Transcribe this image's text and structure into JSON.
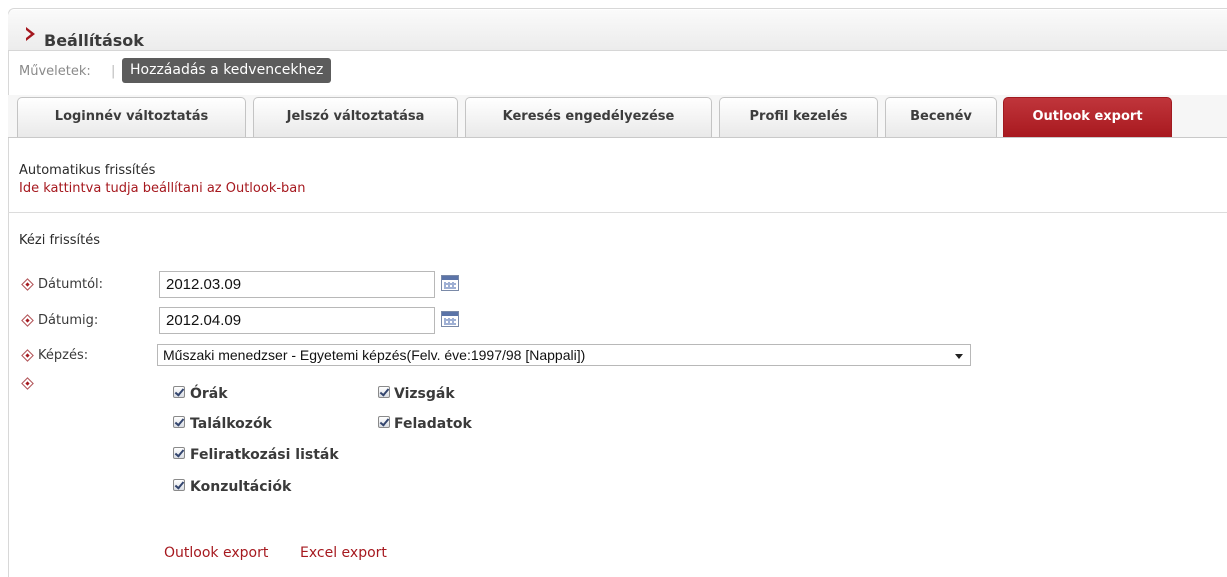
{
  "header": {
    "title": "Beállítások"
  },
  "operations": {
    "label": "Műveletek:",
    "separator": "|",
    "favorite_button": "Hozzáadás a kedvencekhez"
  },
  "tabs": [
    {
      "label": "Loginnév változtatás",
      "active": false
    },
    {
      "label": "Jelszó változtatása",
      "active": false
    },
    {
      "label": "Keresés engedélyezése",
      "active": false
    },
    {
      "label": "Profil kezelés",
      "active": false
    },
    {
      "label": "Becenév",
      "active": false
    },
    {
      "label": "Outlook export",
      "active": true
    }
  ],
  "auto_refresh": {
    "label": "Automatikus frissítés",
    "link": "Ide kattintva tudja beállítani az Outlook-ban"
  },
  "manual_refresh": {
    "label": "Kézi frissítés",
    "date_from": {
      "label": "Dátumtól:",
      "value": "2012.03.09"
    },
    "date_to": {
      "label": "Dátumig:",
      "value": "2012.04.09"
    },
    "training": {
      "label": "Képzés:",
      "value": "Műszaki menedzser - Egyetemi képzés(Felv. éve:1997/98 [Nappali])"
    },
    "checkboxes": [
      {
        "label": "Órák",
        "checked": true
      },
      {
        "label": "Vizsgák",
        "checked": true
      },
      {
        "label": "Találkozók",
        "checked": true
      },
      {
        "label": "Feladatok",
        "checked": true
      },
      {
        "label": "Feliratkozási listák",
        "checked": true
      },
      {
        "label": "Konzultációk",
        "checked": true
      }
    ]
  },
  "actions": {
    "outlook_export": "Outlook export",
    "excel_export": "Excel export"
  },
  "colors": {
    "accent": "#a6191f",
    "active_tab": "#b0232a"
  }
}
